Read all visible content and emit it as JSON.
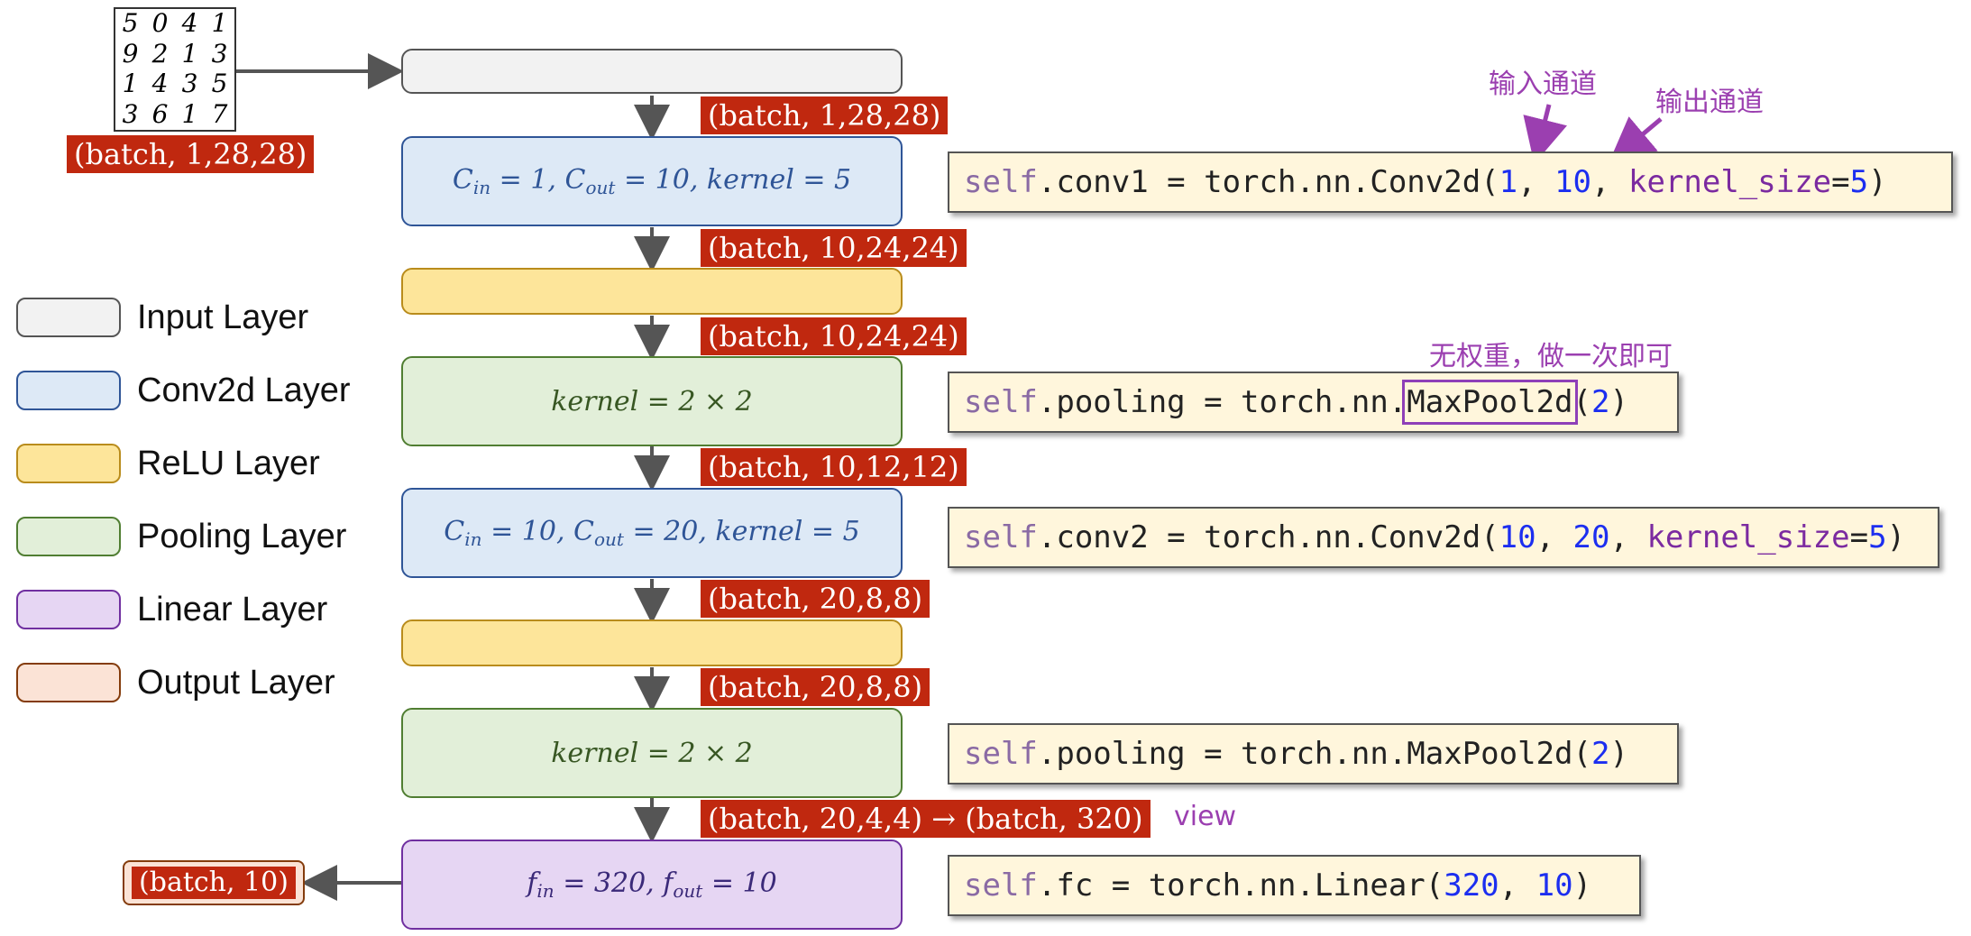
{
  "mnist_digits": [
    "5",
    "0",
    "4",
    "1",
    "9",
    "2",
    "1",
    "3",
    "1",
    "4",
    "3",
    "5",
    "3",
    "6",
    "1",
    "7"
  ],
  "shapes": {
    "input_image": "(batch, 1,28,28)",
    "after_input": "(batch, 1,28,28)",
    "after_conv1": "(batch, 10,24,24)",
    "after_relu1": "(batch, 10,24,24)",
    "after_pool1": "(batch, 10,12,12)",
    "after_conv2": "(batch, 20,8,8)",
    "after_relu2": "(batch, 20,8,8)",
    "after_pool2": "(batch, 20,4,4) → (batch, 320)",
    "output": "(batch, 10)"
  },
  "layers": {
    "conv1": {
      "cin": "1",
      "cout": "10",
      "kernel": "5"
    },
    "pool1": {
      "kernel": "2 × 2"
    },
    "conv2": {
      "cin": "10",
      "cout": "20",
      "kernel": "5"
    },
    "pool2": {
      "kernel": "2 × 2"
    },
    "fc": {
      "fin": "320",
      "fout": "10"
    }
  },
  "code": {
    "conv1": {
      "self": "self",
      "name": ".conv1 = torch.nn.Conv2d(",
      "a": "1",
      "b": "10",
      "param": "kernel_size",
      "eq": "=",
      "v": "5",
      "end": ")"
    },
    "pool1": {
      "self": "self",
      "pre": ".pooling = torch.nn.",
      "fn": "MaxPool2d",
      "open": "(",
      "v": "2",
      "end": ")"
    },
    "conv2": {
      "self": "self",
      "name": ".conv2 = torch.nn.Conv2d(",
      "a": "10",
      "b": "20",
      "param": "kernel_size",
      "eq": "=",
      "v": "5",
      "end": ")"
    },
    "pool2": {
      "self": "self",
      "pre": ".pooling = torch.nn.MaxPool2d(",
      "v": "2",
      "end": ")"
    },
    "fc": {
      "self": "self",
      "name": ".fc = torch.nn.Linear(",
      "a": "320",
      "b": "10",
      "end": ")"
    }
  },
  "annotations": {
    "input_channels": "输入通道",
    "output_channels": "输出通道",
    "no_weights": "无权重，做一次即可",
    "view": "view"
  },
  "legend": [
    {
      "label": "Input Layer",
      "fill": "#f2f2f2",
      "border": "#555555"
    },
    {
      "label": "Conv2d Layer",
      "fill": "#dde9f6",
      "border": "#2f5597"
    },
    {
      "label": "ReLU Layer",
      "fill": "#fde59a",
      "border": "#b98c1c"
    },
    {
      "label": "Pooling Layer",
      "fill": "#e2efd9",
      "border": "#507e32"
    },
    {
      "label": "Linear Layer",
      "fill": "#e6d6f3",
      "border": "#7030a0"
    },
    {
      "label": "Output Layer",
      "fill": "#fbe3d6",
      "border": "#843c0c"
    }
  ]
}
